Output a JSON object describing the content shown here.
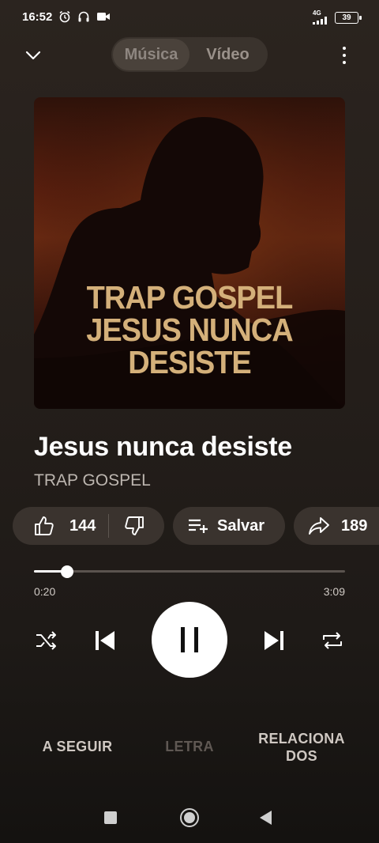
{
  "status_bar": {
    "time": "16:52",
    "network": "4G",
    "battery": "39"
  },
  "header": {
    "tabs": [
      {
        "label": "Música",
        "active": true
      },
      {
        "label": "Vídeo",
        "active": false
      }
    ]
  },
  "artwork": {
    "lines": [
      "TRAP GOSPEL",
      "JESUS NUNCA",
      "DESISTE"
    ],
    "text_color": "#d4b07a"
  },
  "track": {
    "title": "Jesus nunca desiste",
    "artist": "TRAP GOSPEL"
  },
  "actions": {
    "like_count": "144",
    "save_label": "Salvar",
    "share_count": "189"
  },
  "progress": {
    "current": "0:20",
    "total": "3:09",
    "fraction": 0.106
  },
  "bottom_tabs": {
    "next": "A SEGUIR",
    "lyrics": "LETRA",
    "related_line1": "RELACIONA",
    "related_line2": "DOS"
  },
  "colors": {
    "background": "#2b241f",
    "pill": "#3a332e",
    "accent": "#ffffff"
  }
}
